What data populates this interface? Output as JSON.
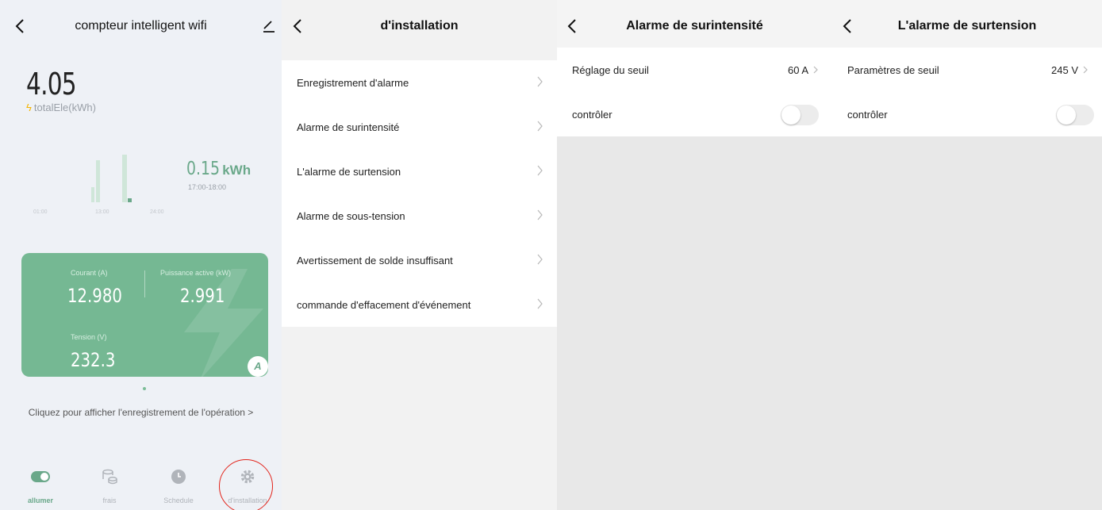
{
  "screen1": {
    "title": "compteur intelligent wifi",
    "total_value": "4.05",
    "total_label": "totalEle(kWh)",
    "chart": {
      "highlight_value": "0.15",
      "highlight_unit": "kWh",
      "highlight_range": "17:00-18:00",
      "tick_labels": [
        "01:00",
        "13:00",
        "24:00"
      ]
    },
    "card": {
      "current_label": "Courant (A)",
      "current_value": "12.980",
      "power_label": "Puissance active (kW)",
      "power_value": "2.991",
      "voltage_label": "Tension (V)",
      "voltage_value": "232.3",
      "badge": "A"
    },
    "op_link": "Cliquez pour afficher l'enregistrement de l'opération >",
    "tabs": [
      {
        "label": "allumer",
        "icon": "toggle-icon",
        "active": true
      },
      {
        "label": "frais",
        "icon": "coins-icon",
        "active": false
      },
      {
        "label": "Schedule",
        "icon": "clock-icon",
        "active": false
      },
      {
        "label": "d'installation",
        "icon": "gear-icon",
        "active": false
      }
    ],
    "accent_color": "#6aa88a",
    "highlight_circle_color": "#e2231a"
  },
  "screen2": {
    "title": "d'installation",
    "items": [
      "Enregistrement d'alarme",
      "Alarme de surintensité",
      "L'alarme de surtension",
      "Alarme de sous-tension",
      "Avertissement de solde insuffisant",
      "commande d'effacement d'événement"
    ]
  },
  "screen3": {
    "title": "Alarme de surintensité",
    "threshold_label": "Réglage du seuil",
    "threshold_value": "60 A",
    "control_label": "contrôler",
    "control_on": false
  },
  "screen4": {
    "title": "L'alarme de surtension",
    "threshold_label": "Paramètres de seuil",
    "threshold_value": "245 V",
    "control_label": "contrôler",
    "control_on": false
  }
}
